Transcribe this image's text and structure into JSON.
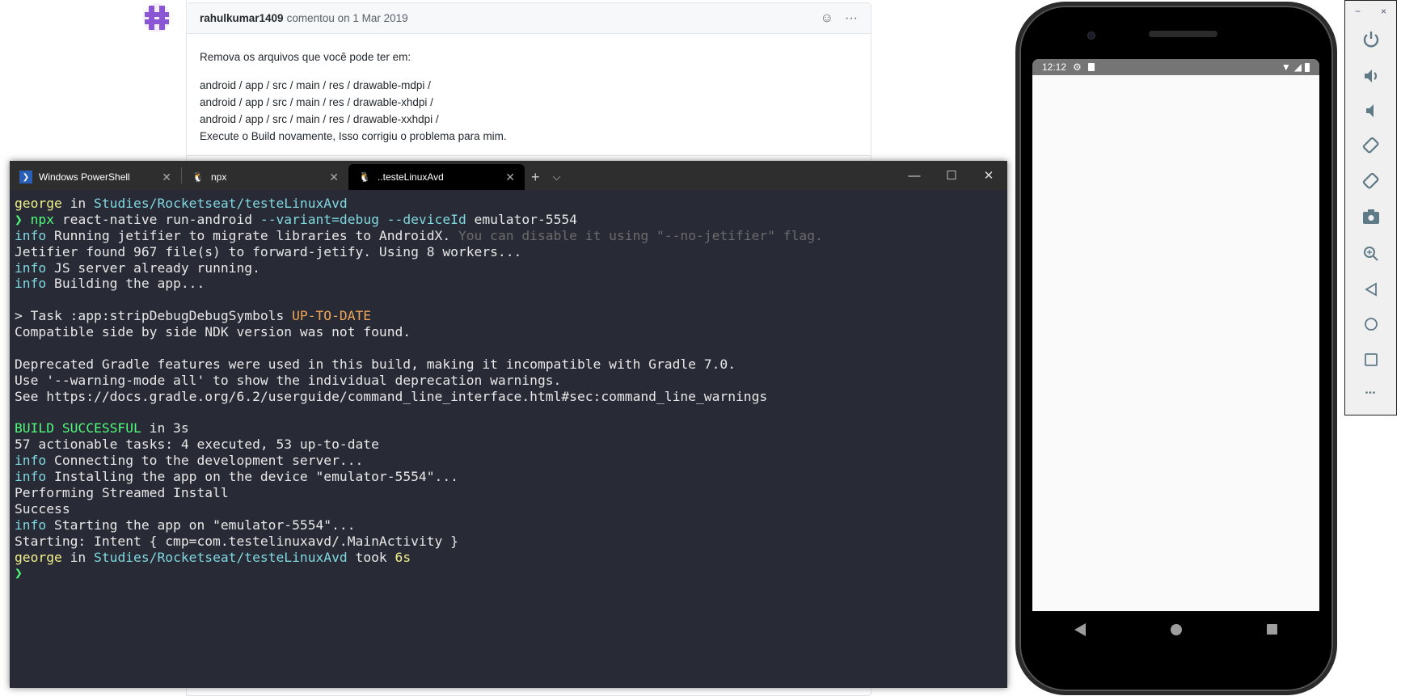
{
  "comment": {
    "author": "rahulkumar1409",
    "meta": "comentou on 1 Mar 2019",
    "intro": "Remova os arquivos que você pode ter em:",
    "paths": [
      "android / app / src / main / res / drawable-mdpi /",
      "android / app / src / main / res / drawable-xhdpi /",
      "android / app / src / main / res / drawable-xxhdpi /"
    ],
    "outro": "Execute o Build novamente, Isso corrigiu o problema para mim.",
    "more": "···"
  },
  "terminal": {
    "tabs": [
      {
        "label": "Windows PowerShell",
        "icon": "powershell-icon"
      },
      {
        "label": "npx",
        "icon": "linux-penguin-icon"
      },
      {
        "label": "..testeLinuxAvd",
        "icon": "linux-penguin-icon",
        "active": true
      }
    ],
    "new_tab": "+",
    "dropdown": "⌵",
    "colors": {
      "w": "#e8e8e8",
      "y": "#f1f08a",
      "c": "#80d8e0",
      "g": "#50fa7b",
      "o": "#f0a656",
      "d": "#6b6b6b"
    },
    "lines": [
      [
        [
          "george",
          "y"
        ],
        [
          " in ",
          "w"
        ],
        [
          "Studies/Rocketseat/testeLinuxAvd",
          "c"
        ]
      ],
      [
        [
          "❯ ",
          "g"
        ],
        [
          "npx",
          "g"
        ],
        [
          " react-native run-android ",
          "w"
        ],
        [
          "--variant=debug --deviceId",
          "c"
        ],
        [
          " emulator-5554",
          "w"
        ]
      ],
      [
        [
          "info",
          "c"
        ],
        [
          " Running jetifier to migrate libraries to AndroidX. ",
          "w"
        ],
        [
          "You can disable it using \"--no-jetifier\" flag.",
          "d"
        ]
      ],
      [
        [
          "Jetifier found 967 file(s) to forward-jetify. Using 8 workers...",
          "w"
        ]
      ],
      [
        [
          "info",
          "c"
        ],
        [
          " JS server already running.",
          "w"
        ]
      ],
      [
        [
          "info",
          "c"
        ],
        [
          " Building the app...",
          "w"
        ]
      ],
      [],
      [
        [
          "> Task :app:stripDebugDebugSymbols ",
          "w"
        ],
        [
          "UP-TO-DATE",
          "o"
        ]
      ],
      [
        [
          "Compatible side by side NDK version was not found.",
          "w"
        ]
      ],
      [],
      [
        [
          "Deprecated Gradle features were used in this build, making it incompatible with Gradle 7.0.",
          "w"
        ]
      ],
      [
        [
          "Use '--warning-mode all' to show the individual deprecation warnings.",
          "w"
        ]
      ],
      [
        [
          "See https://docs.gradle.org/6.2/userguide/command_line_interface.html#sec:command_line_warnings",
          "w"
        ]
      ],
      [],
      [
        [
          "BUILD SUCCESSFUL",
          "g"
        ],
        [
          " in 3s",
          "w"
        ]
      ],
      [
        [
          "57 actionable tasks: 4 executed, 53 up-to-date",
          "w"
        ]
      ],
      [
        [
          "info",
          "c"
        ],
        [
          " Connecting to the development server...",
          "w"
        ]
      ],
      [
        [
          "info",
          "c"
        ],
        [
          " Installing the app on the device \"emulator-5554\"...",
          "w"
        ]
      ],
      [
        [
          "Performing Streamed Install",
          "w"
        ]
      ],
      [
        [
          "Success",
          "w"
        ]
      ],
      [
        [
          "info",
          "c"
        ],
        [
          " Starting the app on \"emulator-5554\"...",
          "w"
        ]
      ],
      [
        [
          "Starting: Intent { cmp=com.testelinuxavd/.MainActivity }",
          "w"
        ]
      ],
      [
        [
          "george",
          "y"
        ],
        [
          " in ",
          "w"
        ],
        [
          "Studies/Rocketseat/testeLinuxAvd",
          "c"
        ],
        [
          " took ",
          "w"
        ],
        [
          "6s",
          "y"
        ]
      ],
      [
        [
          "❯",
          "g"
        ]
      ]
    ]
  },
  "phone": {
    "time": "12:12"
  },
  "panel": {
    "minimize": "−",
    "close": "×",
    "more": "•••"
  }
}
